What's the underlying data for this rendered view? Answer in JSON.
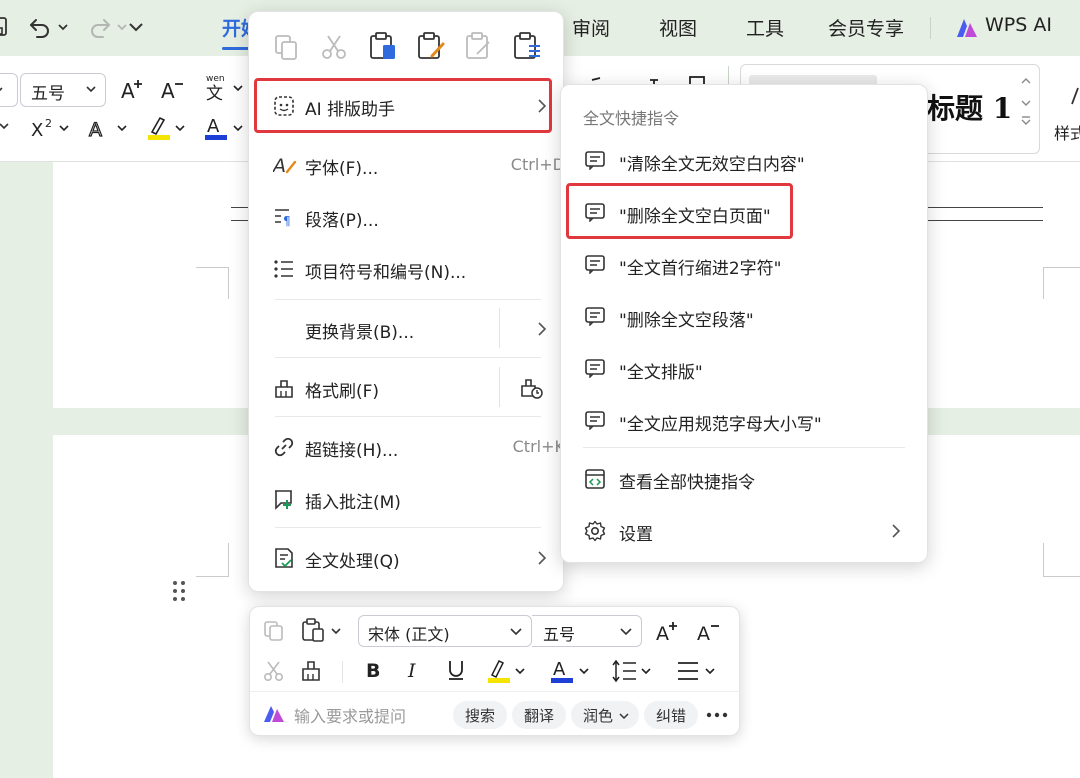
{
  "menubar": {
    "tabs": [
      {
        "label": "开始",
        "active": true
      },
      {
        "label": "审阅"
      },
      {
        "label": "视图"
      },
      {
        "label": "工具"
      },
      {
        "label": "会员专享"
      },
      {
        "label": "WPS AI"
      }
    ]
  },
  "ribbon": {
    "font_size": "五号",
    "style_preview": "标题  1",
    "style_label": "样式"
  },
  "context_menu": {
    "items": [
      {
        "label": "AI 排版助手",
        "shortcut": "",
        "has_submenu": true
      },
      {
        "label": "字体(F)...",
        "shortcut": "Ctrl+D"
      },
      {
        "label": "段落(P)...",
        "shortcut": ""
      },
      {
        "label": "项目符号和编号(N)...",
        "shortcut": ""
      },
      {
        "label": "更换背景(B)...",
        "shortcut": "",
        "has_submenu": true
      },
      {
        "label": "格式刷(F)",
        "shortcut": ""
      },
      {
        "label": "超链接(H)...",
        "shortcut": "Ctrl+K"
      },
      {
        "label": "插入批注(M)",
        "shortcut": ""
      },
      {
        "label": "全文处理(Q)",
        "shortcut": "",
        "has_submenu": true
      }
    ]
  },
  "submenu": {
    "header": "全文快捷指令",
    "items": [
      {
        "label": "\"清除全文无效空白内容\""
      },
      {
        "label": "\"删除全文空白页面\"",
        "highlighted": true
      },
      {
        "label": "\"全文首行缩进2字符\""
      },
      {
        "label": "\"删除全文空段落\""
      },
      {
        "label": "\"全文排版\""
      },
      {
        "label": "\"全文应用规范字母大小写\""
      },
      {
        "label": "查看全部快捷指令"
      },
      {
        "label": "设置",
        "has_submenu": true
      }
    ]
  },
  "mini_toolbar": {
    "font_name": "宋体 (正文)",
    "font_size": "五号",
    "ai_placeholder": "输入要求或提问",
    "chips": [
      "搜索",
      "翻译",
      "润色",
      "纠错"
    ]
  },
  "colors": {
    "accent": "#2f6bdc",
    "highlight_border": "#e0383e",
    "background": "#e6efe4",
    "highlighter_yellow": "#f5e400",
    "font_color_blue": "#1d3fd6"
  }
}
